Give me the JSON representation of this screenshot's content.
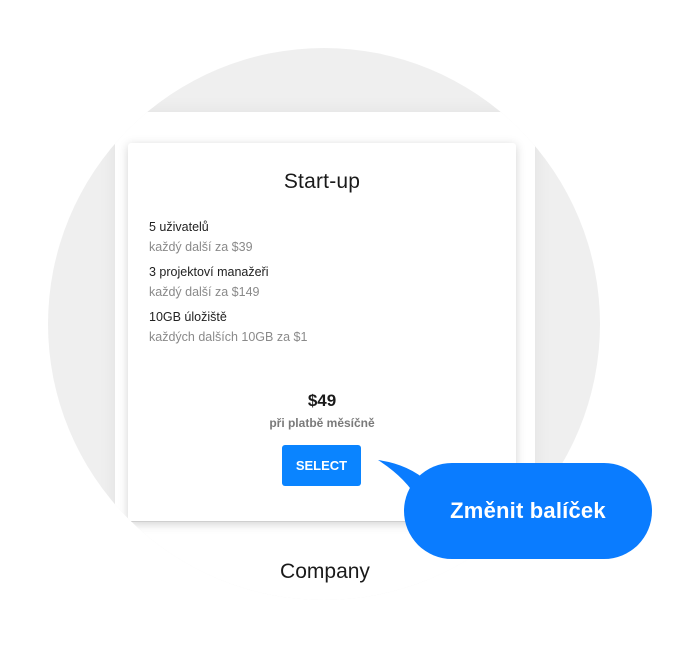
{
  "plan": {
    "title": "Start-up",
    "features": [
      {
        "main": "5 uživatelů",
        "sub": "každý další za $39"
      },
      {
        "main": "3 projektoví manažeři",
        "sub": "každý další za $149"
      },
      {
        "main": "10GB úložiště",
        "sub": "každých dalších 10GB za $1"
      }
    ],
    "price": "$49",
    "price_note": "při platbě měsíčně",
    "select_label": "SELECT"
  },
  "next_plan": {
    "title": "Company"
  },
  "callout": {
    "text": "Změnit balíček"
  },
  "colors": {
    "accent": "#0a84ff",
    "callout": "#0a7cff",
    "backdrop": "#efefef"
  }
}
